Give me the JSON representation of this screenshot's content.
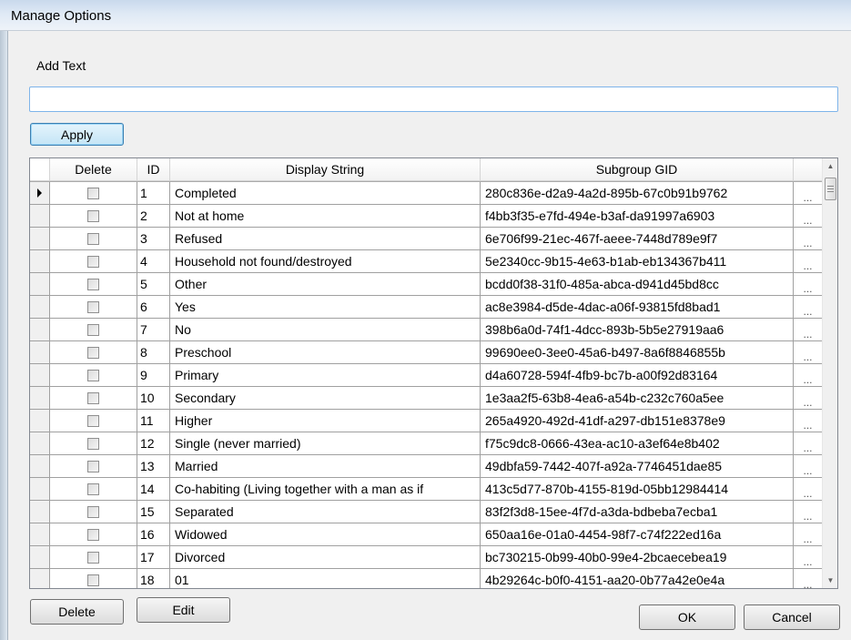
{
  "window": {
    "title": "Manage Options"
  },
  "form": {
    "add_label": "Add Text",
    "input_value": "",
    "apply_label": "Apply",
    "delete_label": "Delete",
    "edit_label": "Edit",
    "ok_label": "OK",
    "cancel_label": "Cancel"
  },
  "grid": {
    "columns": [
      "Delete",
      "ID",
      "Display String",
      "Subgroup GID",
      ""
    ],
    "ellipsis": "...",
    "rows": [
      {
        "id": "1",
        "display": "Completed",
        "gid": "280c836e-d2a9-4a2d-895b-67c0b91b9762"
      },
      {
        "id": "2",
        "display": "Not at home",
        "gid": "f4bb3f35-e7fd-494e-b3af-da91997a6903"
      },
      {
        "id": "3",
        "display": "Refused",
        "gid": "6e706f99-21ec-467f-aeee-7448d789e9f7"
      },
      {
        "id": "4",
        "display": "Household not found/destroyed",
        "gid": "5e2340cc-9b15-4e63-b1ab-eb134367b411"
      },
      {
        "id": "5",
        "display": "Other",
        "gid": "bcdd0f38-31f0-485a-abca-d941d45bd8cc"
      },
      {
        "id": "6",
        "display": "Yes",
        "gid": "ac8e3984-d5de-4dac-a06f-93815fd8bad1"
      },
      {
        "id": "7",
        "display": "No",
        "gid": "398b6a0d-74f1-4dcc-893b-5b5e27919aa6"
      },
      {
        "id": "8",
        "display": "Preschool",
        "gid": "99690ee0-3ee0-45a6-b497-8a6f8846855b"
      },
      {
        "id": "9",
        "display": "Primary",
        "gid": "d4a60728-594f-4fb9-bc7b-a00f92d83164"
      },
      {
        "id": "10",
        "display": "Secondary",
        "gid": "1e3aa2f5-63b8-4ea6-a54b-c232c760a5ee"
      },
      {
        "id": "11",
        "display": "Higher",
        "gid": "265a4920-492d-41df-a297-db151e8378e9"
      },
      {
        "id": "12",
        "display": "Single (never married)",
        "gid": "f75c9dc8-0666-43ea-ac10-a3ef64e8b402"
      },
      {
        "id": "13",
        "display": "Married",
        "gid": "49dbfa59-7442-407f-a92a-7746451dae85"
      },
      {
        "id": "14",
        "display": "Co-habiting (Living together with a man as if",
        "gid": "413c5d77-870b-4155-819d-05bb12984414"
      },
      {
        "id": "15",
        "display": "Separated",
        "gid": "83f2f3d8-15ee-4f7d-a3da-bdbeba7ecba1"
      },
      {
        "id": "16",
        "display": "Widowed",
        "gid": "650aa16e-01a0-4454-98f7-c74f222ed16a"
      },
      {
        "id": "17",
        "display": "Divorced",
        "gid": "bc730215-0b99-40b0-99e4-2bcaecebea19"
      },
      {
        "id": "18",
        "display": "01",
        "gid": "4b29264c-b0f0-4151-aa20-0b77a42e0e4a"
      }
    ]
  }
}
